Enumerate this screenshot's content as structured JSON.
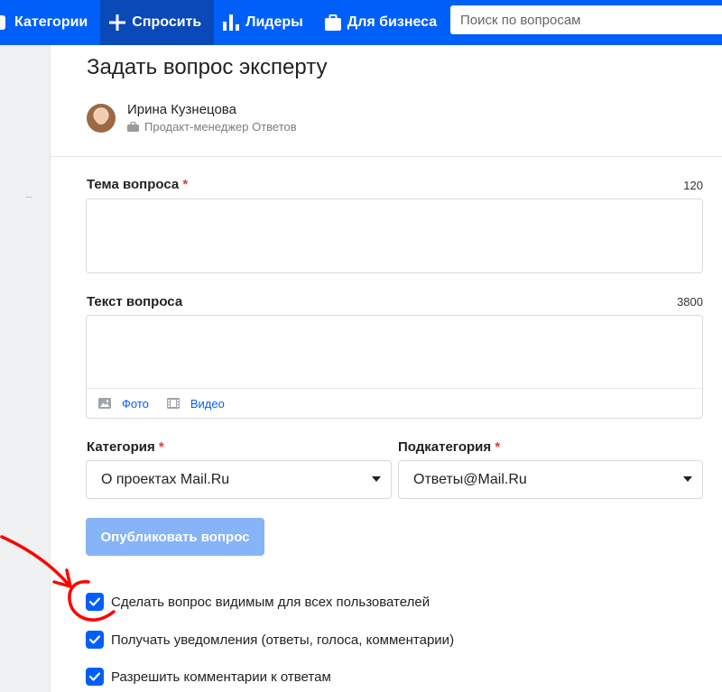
{
  "nav": {
    "categories": "Категории",
    "ask": "Спросить",
    "leaders": "Лидеры",
    "business": "Для бизнеса",
    "search_placeholder": "Поиск по вопросам"
  },
  "page": {
    "title": "Задать вопрос эксперту"
  },
  "expert": {
    "name": "Ирина Кузнецова",
    "role": "Продакт-менеджер Ответов"
  },
  "form": {
    "topic_label": "Тема вопроса",
    "topic_counter": "120",
    "text_label": "Текст вопроса",
    "text_counter": "3800",
    "photo": "Фото",
    "video": "Видео",
    "category_label": "Категория",
    "category_value": "О проектах Mail.Ru",
    "subcategory_label": "Подкатегория",
    "subcategory_value": "Ответы@Mail.Ru",
    "required_mark": "*",
    "publish": "Опубликовать вопрос"
  },
  "options": [
    {
      "label": "Сделать вопрос видимым для всех пользователей",
      "checked": true
    },
    {
      "label": "Получать уведомления (ответы, голоса, комментарии)",
      "checked": true
    },
    {
      "label": "Разрешить комментарии к ответам",
      "checked": true
    }
  ],
  "colors": {
    "brand": "#005ff9",
    "nav_active": "#0949b8",
    "publish_disabled": "#87b3f7",
    "required": "#e53935",
    "annotation": "#ff0000"
  }
}
